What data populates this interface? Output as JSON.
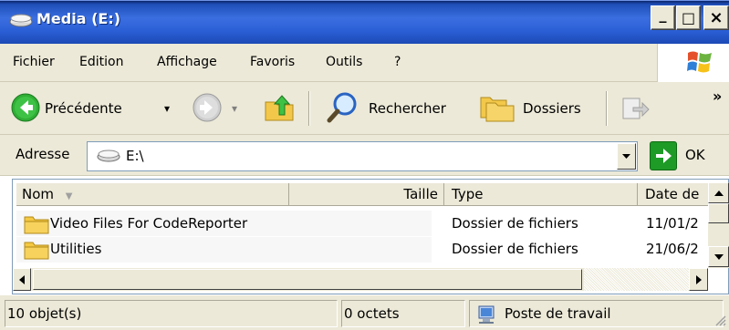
{
  "window": {
    "title": "Media (E:)",
    "title_icon": "drive-icon",
    "min_glyph": "_",
    "max_glyph": "□",
    "close_glyph": "×"
  },
  "menu": {
    "items": [
      "Fichier",
      "Edition",
      "Affichage",
      "Favoris",
      "Outils",
      "?"
    ]
  },
  "toolbar": {
    "back_label": "Précédente",
    "search_label": "Rechercher",
    "folders_label": "Dossiers",
    "overflow_glyph": "»",
    "dropdown_glyph": "▾"
  },
  "address": {
    "label": "Adresse",
    "value": "E:\\",
    "go_label": "OK"
  },
  "list": {
    "columns": [
      {
        "label": "Nom",
        "sort_glyph": "▼"
      },
      {
        "label": "Taille"
      },
      {
        "label": "Type"
      },
      {
        "label": "Date de"
      }
    ],
    "rows": [
      {
        "name": "Video Files For CodeReporter",
        "size": "",
        "type": "Dossier de fichiers",
        "date": "11/01/2"
      },
      {
        "name": "Utilities",
        "size": "",
        "type": "Dossier de fichiers",
        "date": "21/06/2"
      }
    ]
  },
  "status": {
    "count": "10 objet(s)",
    "size": "0 octets",
    "zone": "Poste de travail"
  },
  "colors": {
    "titlebar": "#2b5fd6",
    "chrome": "#ece9d8",
    "folder": "#f5c842",
    "back_green": "#2fae35"
  }
}
